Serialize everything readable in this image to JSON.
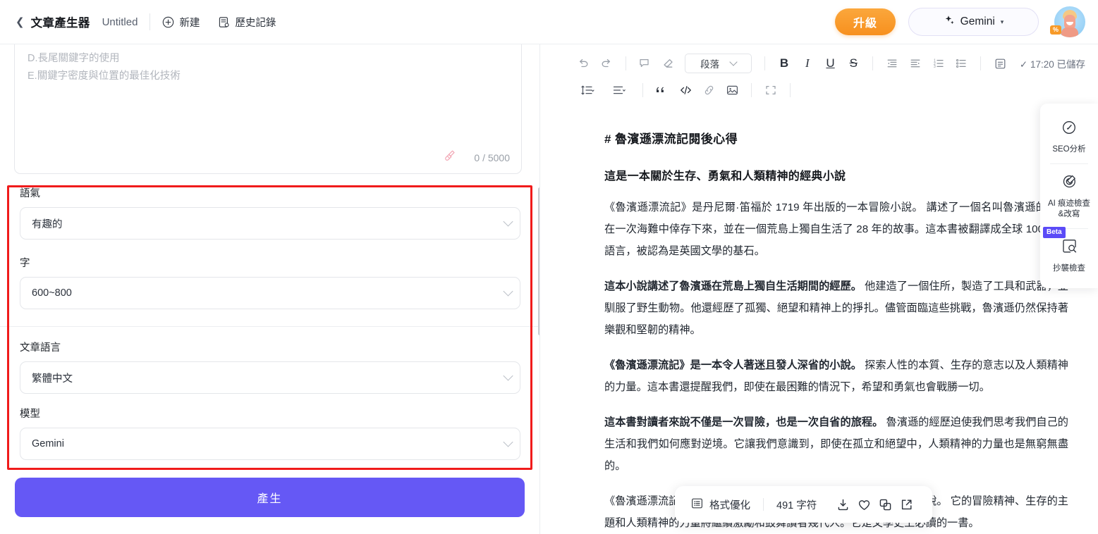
{
  "header": {
    "back_icon": "chevron-left-icon",
    "app_title": "文章產生器",
    "doc_name": "Untitled",
    "new_label": "新建",
    "history_label": "歷史記錄",
    "upgrade_label": "升級",
    "model_label": "Gemini",
    "model_caret": "▾",
    "avatar_badge": "%"
  },
  "left": {
    "prompt_text": "D.長尾關鍵字的使用\nE.關鍵字密度與位置的最佳化技術",
    "counter": "0 / 5000",
    "fields": [
      {
        "label": "語氣",
        "value": "有趣的"
      },
      {
        "label": "字",
        "value": "600~800"
      },
      {
        "label": "文章語言",
        "value": "繁體中文"
      },
      {
        "label": "模型",
        "value": "Gemini"
      }
    ],
    "generate_label": "產生"
  },
  "toolbar": {
    "undo": "undo-icon",
    "redo": "redo-icon",
    "comment": "comment-icon",
    "eraser": "eraser-icon",
    "block_style": "段落",
    "bold": "B",
    "italic": "I",
    "underline": "U",
    "strike": "S",
    "saved_status": "✓ 17:20 已儲存"
  },
  "document": {
    "h1": "# 魯濱遜漂流記閱後心得",
    "h2": "這是一本關於生存、勇氣和人類精神的經典小說",
    "paragraphs": [
      {
        "lead": "",
        "text": "《魯濱遜漂流記》是丹尼爾·笛福於 1719 年出版的一本冒險小說。 講述了一個名叫魯濱遜的水手在一次海難中倖存下來，並在一個荒島上獨自生活了 28 年的故事。這本書被翻譯成全球 100 多種語言，被認為是英國文學的基石。"
      },
      {
        "lead": "這本小說講述了魯濱遜在荒島上獨自生活期間的經歷。",
        "text": " 他建造了一個住所，製造了工具和武器，並馴服了野生動物。他還經歷了孤獨、絕望和精神上的掙扎。儘管面臨這些挑戰，魯濱遜仍然保持著樂觀和堅韌的精神。"
      },
      {
        "lead": "《魯濱遜漂流記》是一本令人著迷且發人深省的小說。",
        "text": " 探索人性的本質、生存的意志以及人類精神的力量。這本書還提醒我們，即使在最困難的情況下，希望和勇氣也會戰勝一切。"
      },
      {
        "lead": "這本書對讀者來說不僅是一次冒險，也是一次自省的旅程。",
        "text": " 魯濱遜的經歷迫使我們思考我們自己的生活和我們如何應對逆境。它讓我們意識到，即使在孤立和絕望中，人類精神的力量也是無窮無盡的。"
      },
      {
        "lead": "",
        "text": "《魯濱遜漂流記》是一本對所有年齡段的讀者都有啟發意義的經典小說。 它的冒險精神、生存的主題和人類精神的力量將繼續激勵和鼓舞讀者幾代人。它是文學史上必讀的一書。"
      }
    ]
  },
  "bottom_bar": {
    "format_label": "格式優化",
    "char_count": "491 字符",
    "download_icon": "download-icon",
    "favorite_icon": "heart-icon",
    "copy_icon": "copy-icon",
    "export_icon": "external-link-icon"
  },
  "rail": {
    "items": [
      {
        "icon": "gauge-icon",
        "label": "SEO分析",
        "badge": ""
      },
      {
        "icon": "target-pen-icon",
        "label": "AI 痕迹檢查\n&改寫",
        "badge": ""
      },
      {
        "icon": "plagiarism-search-icon",
        "label": "抄襲檢查",
        "badge": "Beta"
      }
    ]
  },
  "colors": {
    "accent_purple": "#6558f5",
    "upgrade_orange": "#f7901e",
    "highlight_red": "#f01b1b",
    "beta_blue": "#5b4bf7"
  }
}
